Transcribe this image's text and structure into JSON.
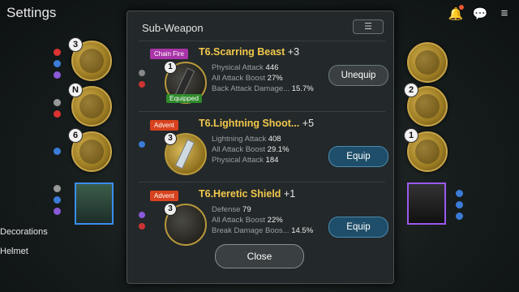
{
  "header": {
    "title": "Settings"
  },
  "side_labels": {
    "decorations": "Decorations",
    "helmet": "Helmet"
  },
  "left_slots": [
    {
      "badge": "3"
    },
    {
      "badge": "N"
    },
    {
      "badge": "6"
    }
  ],
  "right_slots": [
    {
      "badge": ""
    },
    {
      "badge": "2"
    },
    {
      "badge": "1"
    }
  ],
  "modal": {
    "title": "Sub-Weapon",
    "sort_icon": "list-sort-icon",
    "items": [
      {
        "tag": "Chain Fire",
        "tag_color": "#a835a8",
        "name": "T6.Scarring Beast",
        "plus": "+3",
        "level": "1",
        "equipped_label": "Equipped",
        "stats": [
          {
            "label": "Physical Attack",
            "value": "446"
          },
          {
            "label": "All Attack Boost",
            "value": "27%"
          },
          {
            "label": "Back Attack Damage...",
            "value": "15.7%"
          }
        ],
        "action": "Unequip"
      },
      {
        "tag": "Advent",
        "tag_color": "#d8421e",
        "name": "T6.Lightning Shoot...",
        "plus": "+5",
        "level": "3",
        "stats": [
          {
            "label": "Lightning Attack",
            "value": "408"
          },
          {
            "label": "All Attack Boost",
            "value": "29.1%"
          },
          {
            "label": "Physical Attack",
            "value": "184"
          }
        ],
        "action": "Equip"
      },
      {
        "tag": "Advent",
        "tag_color": "#d8421e",
        "name": "T6.Heretic Shield",
        "plus": "+1",
        "level": "3",
        "stats": [
          {
            "label": "Defense",
            "value": "79"
          },
          {
            "label": "All Attack Boost",
            "value": "22%"
          },
          {
            "label": "Break Damage Boos...",
            "value": "14.5%"
          }
        ],
        "action": "Equip"
      }
    ],
    "close_label": "Close"
  }
}
